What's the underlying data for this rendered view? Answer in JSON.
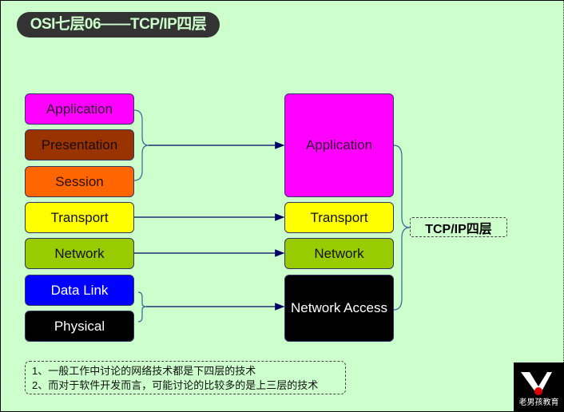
{
  "title": "OSI七层06——TCP/IP四层",
  "osi_layers": [
    {
      "label": "Application",
      "color": "#ff00ff",
      "text_color": "#330033"
    },
    {
      "label": "Presentation",
      "color": "#993300",
      "text_color": "#1a0a00"
    },
    {
      "label": "Session",
      "color": "#ff6600",
      "text_color": "#2a0f00"
    },
    {
      "label": "Transport",
      "color": "#ffff00",
      "text_color": "#111111"
    },
    {
      "label": "Network",
      "color": "#99cc00",
      "text_color": "#111111"
    },
    {
      "label": "Data Link",
      "color": "#0000ff",
      "text_color": "#ffffff"
    },
    {
      "label": "Physical",
      "color": "#000000",
      "text_color": "#ffffff"
    }
  ],
  "tcpip_layers": [
    {
      "label": "Application",
      "color": "#ff00ff",
      "text_color": "#330033"
    },
    {
      "label": "Transport",
      "color": "#ffff00",
      "text_color": "#111111"
    },
    {
      "label": "Network",
      "color": "#99cc00",
      "text_color": "#111111"
    },
    {
      "label": "Network Access",
      "color": "#000000",
      "text_color": "#ffffff"
    }
  ],
  "tcpip_group_label": "TCP/IP四层",
  "notes": [
    "1、一般工作中讨论的网络技术都是下四层的技术",
    "2、而对于软件开发而言，可能讨论的比较多的是上三层的技术"
  ],
  "logo": {
    "text": "老男孩教育"
  },
  "colors": {
    "background": "#ccffcc",
    "line": "#000066",
    "title_bg": "#333333"
  }
}
